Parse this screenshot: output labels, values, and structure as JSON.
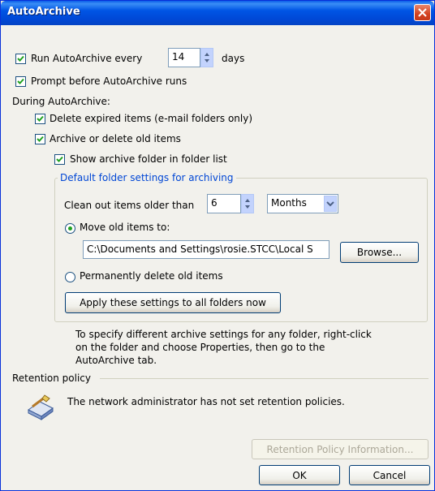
{
  "window": {
    "title": "AutoArchive"
  },
  "run_autoarchive": {
    "label": "Run AutoArchive every",
    "checked": true,
    "days_value": "14",
    "days_label": "days"
  },
  "prompt_before": {
    "label": "Prompt before AutoArchive runs",
    "checked": true
  },
  "during_label": "During AutoArchive:",
  "delete_expired": {
    "label": "Delete expired items (e-mail folders only)",
    "checked": true
  },
  "archive_old": {
    "label": "Archive or delete old items",
    "checked": true
  },
  "show_archive_folder": {
    "label": "Show archive folder in folder list",
    "checked": true
  },
  "default_settings": {
    "title": "Default folder settings for archiving",
    "clean_label": "Clean out items older than",
    "clean_value": "6",
    "unit": "Months",
    "move_label": "Move old items to:",
    "move_selected": true,
    "path": "C:\\Documents and Settings\\rosie.STCC\\Local S",
    "browse": "Browse...",
    "delete_label": "Permanently delete old items",
    "apply_button": "Apply these settings to all folders now"
  },
  "info_text": {
    "line1": "To specify different archive settings for any folder, right-click",
    "line2": "on the folder and choose Properties, then go to the",
    "line3": "AutoArchive tab."
  },
  "retention": {
    "label": "Retention policy",
    "message": "The network administrator has not set retention policies.",
    "info_button": "Retention Policy Information..."
  },
  "buttons": {
    "ok": "OK",
    "cancel": "Cancel"
  },
  "icons": {
    "close": "close-icon",
    "retention": "retention-policy-icon",
    "checkmark": "checkmark-icon",
    "spinner": "spinner-arrows-icon",
    "dropdown": "chevron-down-icon"
  }
}
